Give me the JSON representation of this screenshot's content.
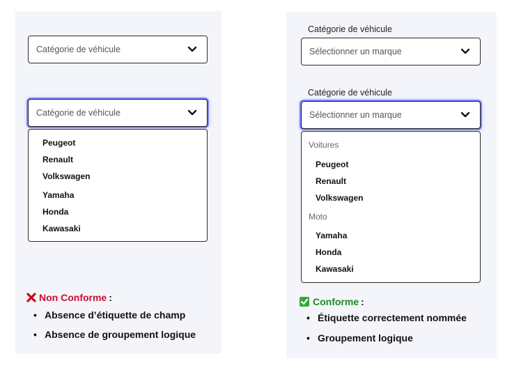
{
  "left": {
    "select_closed": {
      "value": "Catégorie de véhicule"
    },
    "select_open": {
      "value": "Catégorie de véhicule"
    },
    "options": [
      "Peugeot",
      "Renault",
      "Volkswagen",
      "Yamaha",
      "Honda",
      "Kawasaki"
    ],
    "verdict": {
      "label": "Non Conforme",
      "colon": ":",
      "color": "#c8102e"
    },
    "bullets": [
      "Absence d’étiquette de champ",
      "Absence de groupement logique"
    ]
  },
  "right": {
    "field1": {
      "label": "Catégorie de véhicule",
      "placeholder": "Sélectionner un marque"
    },
    "field2": {
      "label": "Catégorie de véhicule",
      "placeholder": "Sélectionner un marque"
    },
    "groups": [
      {
        "label": "Voitures",
        "options": [
          "Peugeot",
          "Renault",
          "Volkswagen"
        ]
      },
      {
        "label": "Moto",
        "options": [
          "Yamaha",
          "Honda",
          "Kawasaki"
        ]
      }
    ],
    "verdict": {
      "label": "Conforme",
      "colon": ":",
      "color": "#1f8a22"
    },
    "bullets": [
      "Étiquette correctement nommée",
      "Groupement logique"
    ]
  },
  "icons": {
    "chevron": "chevron-down-icon",
    "cross": "cross-mark-icon",
    "check": "check-mark-icon"
  }
}
